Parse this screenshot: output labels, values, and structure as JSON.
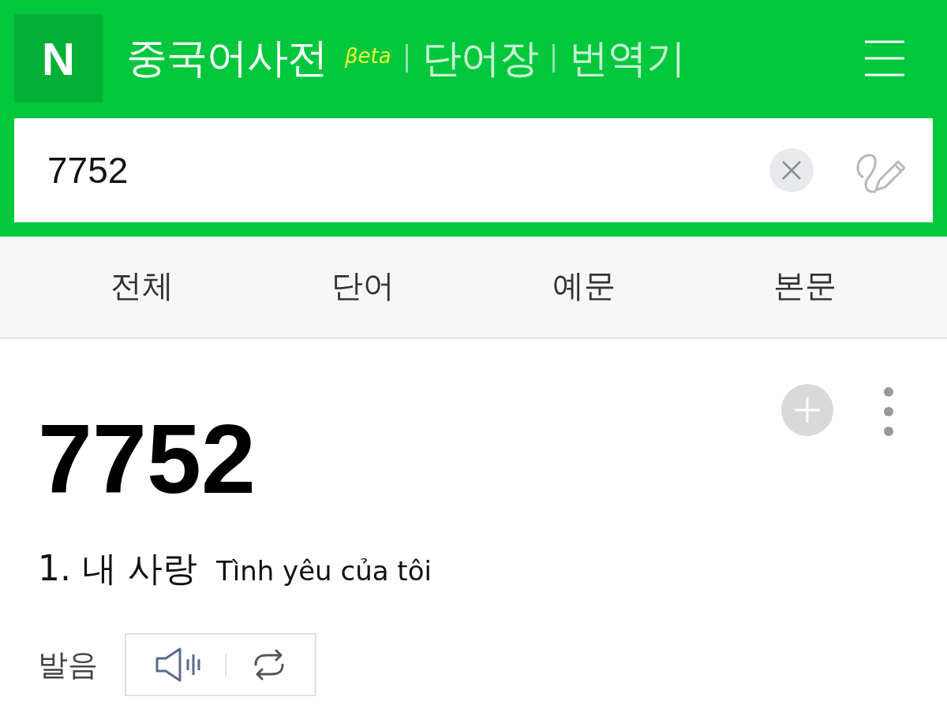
{
  "header": {
    "logo": "N",
    "title": "중국어사전",
    "badge": "βeta",
    "links": [
      {
        "label": "단어장"
      },
      {
        "label": "번역기"
      }
    ]
  },
  "search": {
    "value": "7752"
  },
  "tabs": [
    {
      "label": "전체",
      "selected": false
    },
    {
      "label": "단어",
      "selected": false
    },
    {
      "label": "예문",
      "selected": false
    },
    {
      "label": "본문",
      "selected": false
    }
  ],
  "entry": {
    "word": "7752",
    "meanings": [
      {
        "text": "1. 내 사랑",
        "note": "Tình yêu của tôi"
      }
    ],
    "pronunciation_label": "발음"
  }
}
